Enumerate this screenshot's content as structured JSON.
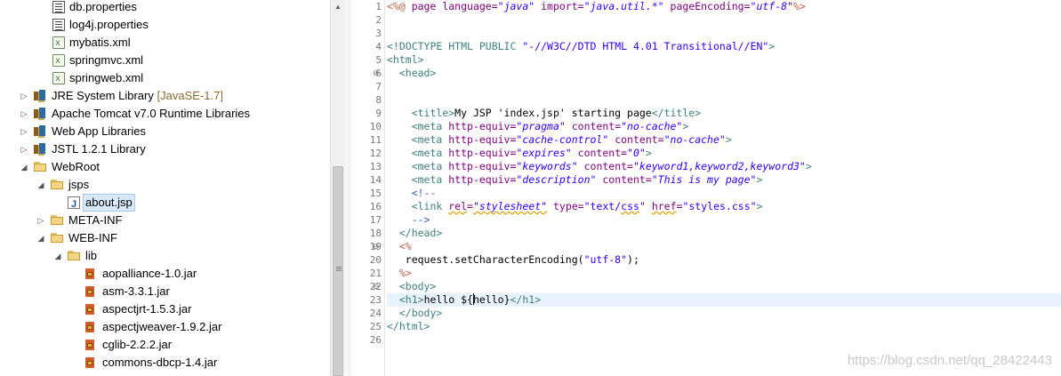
{
  "explorer": {
    "items": [
      {
        "label": "db.properties",
        "icon": "properties-file-icon"
      },
      {
        "label": "log4j.properties",
        "icon": "properties-file-icon"
      },
      {
        "label": "mybatis.xml",
        "icon": "xml-file-icon"
      },
      {
        "label": "springmvc.xml",
        "icon": "xml-file-icon"
      },
      {
        "label": "springweb.xml",
        "icon": "xml-file-icon"
      },
      {
        "label": "JRE System Library",
        "suffix": "[JavaSE-1.7]",
        "icon": "library-icon"
      },
      {
        "label": "Apache Tomcat v7.0 Runtime Libraries",
        "icon": "library-icon"
      },
      {
        "label": "Web App Libraries",
        "icon": "library-icon"
      },
      {
        "label": "JSTL 1.2.1 Library",
        "icon": "library-icon"
      },
      {
        "label": "WebRoot",
        "icon": "folder-open-icon"
      },
      {
        "label": "jsps",
        "icon": "folder-open-icon"
      },
      {
        "label": "about.jsp",
        "icon": "jsp-file-icon",
        "selected": true
      },
      {
        "label": "META-INF",
        "icon": "folder-icon"
      },
      {
        "label": "WEB-INF",
        "icon": "folder-open-icon"
      },
      {
        "label": "lib",
        "icon": "folder-open-icon"
      },
      {
        "label": "aopalliance-1.0.jar",
        "icon": "jar-icon"
      },
      {
        "label": "asm-3.3.1.jar",
        "icon": "jar-icon"
      },
      {
        "label": "aspectjrt-1.5.3.jar",
        "icon": "jar-icon"
      },
      {
        "label": "aspectjweaver-1.9.2.jar",
        "icon": "jar-icon"
      },
      {
        "label": "cglib-2.2.2.jar",
        "icon": "jar-icon"
      },
      {
        "label": "commons-dbcp-1.4.jar",
        "icon": "jar-icon"
      }
    ]
  },
  "editor": {
    "line_numbers": [
      "1",
      "2",
      "3",
      "4",
      "5",
      "6",
      "7",
      "8",
      "9",
      "10",
      "11",
      "12",
      "13",
      "14",
      "15",
      "16",
      "17",
      "18",
      "19",
      "20",
      "21",
      "22",
      "23",
      "24",
      "25",
      "26"
    ],
    "current_line": "23",
    "colors": {
      "tag": "#3f7f7f",
      "attribute": "#7f007f",
      "string": "#2a00ff",
      "jsp_delimiter": "#bf5f3f",
      "comment": "#3f5fbf",
      "current_line_bg": "#e8f2fe"
    },
    "lines": [
      [
        {
          "t": "<%@ ",
          "c": "jsp"
        },
        {
          "t": "page ",
          "c": "kwplain"
        },
        {
          "t": "language=",
          "c": "attr"
        },
        {
          "t": "\"java\"",
          "c": "str"
        },
        {
          "t": " import=",
          "c": "attr"
        },
        {
          "t": "\"java.util.*\"",
          "c": "str"
        },
        {
          "t": " pageEncoding=",
          "c": "attr"
        },
        {
          "t": "\"utf-8\"",
          "c": "str"
        },
        {
          "t": "%>",
          "c": "jsp"
        }
      ],
      [],
      [],
      [
        {
          "t": "<!DOCTYPE ",
          "c": "tag"
        },
        {
          "t": "HTML PUBLIC ",
          "c": "tag"
        },
        {
          "t": "\"-//W3C//DTD HTML 4.01 Transitional//EN\"",
          "c": "strn"
        },
        {
          "t": ">",
          "c": "tag"
        }
      ],
      [
        {
          "t": "<html>",
          "c": "tag"
        }
      ],
      [
        {
          "t": "  ",
          "c": "txt"
        },
        {
          "t": "<head>",
          "c": "tag"
        }
      ],
      [],
      [],
      [
        {
          "t": "    ",
          "c": "txt"
        },
        {
          "t": "<title>",
          "c": "tag"
        },
        {
          "t": "My JSP 'index.jsp' starting page",
          "c": "txt"
        },
        {
          "t": "</title>",
          "c": "tag"
        }
      ],
      [
        {
          "t": "    ",
          "c": "txt"
        },
        {
          "t": "<meta ",
          "c": "tag"
        },
        {
          "t": "http-equiv=",
          "c": "attr"
        },
        {
          "t": "\"pragma\"",
          "c": "str"
        },
        {
          "t": " content=",
          "c": "attr"
        },
        {
          "t": "\"no-cache\"",
          "c": "str"
        },
        {
          "t": ">",
          "c": "tag"
        }
      ],
      [
        {
          "t": "    ",
          "c": "txt"
        },
        {
          "t": "<meta ",
          "c": "tag"
        },
        {
          "t": "http-equiv=",
          "c": "attr"
        },
        {
          "t": "\"cache-control\"",
          "c": "str"
        },
        {
          "t": " content=",
          "c": "attr"
        },
        {
          "t": "\"no-cache\"",
          "c": "str"
        },
        {
          "t": ">",
          "c": "tag"
        }
      ],
      [
        {
          "t": "    ",
          "c": "txt"
        },
        {
          "t": "<meta ",
          "c": "tag"
        },
        {
          "t": "http-equiv=",
          "c": "attr"
        },
        {
          "t": "\"expires\"",
          "c": "str"
        },
        {
          "t": " content=",
          "c": "attr"
        },
        {
          "t": "\"0\"",
          "c": "str"
        },
        {
          "t": ">",
          "c": "tag"
        }
      ],
      [
        {
          "t": "    ",
          "c": "txt"
        },
        {
          "t": "<meta ",
          "c": "tag"
        },
        {
          "t": "http-equiv=",
          "c": "attr"
        },
        {
          "t": "\"keywords\"",
          "c": "str"
        },
        {
          "t": " content=",
          "c": "attr"
        },
        {
          "t": "\"keyword1,keyword2,keyword3\"",
          "c": "str"
        },
        {
          "t": ">",
          "c": "tag"
        }
      ],
      [
        {
          "t": "    ",
          "c": "txt"
        },
        {
          "t": "<meta ",
          "c": "tag"
        },
        {
          "t": "http-equiv=",
          "c": "attr"
        },
        {
          "t": "\"description\"",
          "c": "str"
        },
        {
          "t": " content=",
          "c": "attr"
        },
        {
          "t": "\"This is my page\"",
          "c": "str"
        },
        {
          "t": ">",
          "c": "tag"
        }
      ],
      [
        {
          "t": "    ",
          "c": "txt"
        },
        {
          "t": "<!--",
          "c": "cmt"
        }
      ],
      [
        {
          "t": "    ",
          "c": "txt"
        },
        {
          "t": "<link ",
          "c": "tag"
        },
        {
          "t": "rel",
          "c": "attrsq"
        },
        {
          "t": "=",
          "c": "attr"
        },
        {
          "t": "\"stylesheet\"",
          "c": "strsq"
        },
        {
          "t": " type=",
          "c": "attr"
        },
        {
          "t": "\"text/",
          "c": "strn"
        },
        {
          "t": "css",
          "c": "strnsq"
        },
        {
          "t": "\"",
          "c": "strn"
        },
        {
          "t": " ",
          "c": "txt"
        },
        {
          "t": "href",
          "c": "attrsq"
        },
        {
          "t": "=",
          "c": "attr"
        },
        {
          "t": "\"styles.css\"",
          "c": "strn"
        },
        {
          "t": ">",
          "c": "tag"
        }
      ],
      [
        {
          "t": "    ",
          "c": "txt"
        },
        {
          "t": "-->",
          "c": "cmt"
        }
      ],
      [
        {
          "t": "  ",
          "c": "txt"
        },
        {
          "t": "</head>",
          "c": "tag"
        }
      ],
      [
        {
          "t": "  ",
          "c": "txt"
        },
        {
          "t": "<%",
          "c": "jsp"
        }
      ],
      [
        {
          "t": "   request.setCharacterEncoding(",
          "c": "txt"
        },
        {
          "t": "\"utf-8\"",
          "c": "strn"
        },
        {
          "t": ");",
          "c": "txt"
        }
      ],
      [
        {
          "t": "  ",
          "c": "txt"
        },
        {
          "t": "%>",
          "c": "jsp"
        }
      ],
      [
        {
          "t": "  ",
          "c": "txt"
        },
        {
          "t": "<body>",
          "c": "tag"
        }
      ],
      [
        {
          "t": "  ",
          "c": "txt"
        },
        {
          "t": "<h1>",
          "c": "tag"
        },
        {
          "t": "hello ${",
          "c": "txt"
        },
        {
          "t": "|",
          "c": "caret"
        },
        {
          "t": "hello}",
          "c": "txt"
        },
        {
          "t": "</h1>",
          "c": "tag"
        }
      ],
      [
        {
          "t": "  ",
          "c": "txt"
        },
        {
          "t": "</body>",
          "c": "tag"
        }
      ],
      [
        {
          "t": "</html>",
          "c": "tag"
        }
      ],
      []
    ]
  },
  "watermark": "https://blog.csdn.net/qq_28422443"
}
